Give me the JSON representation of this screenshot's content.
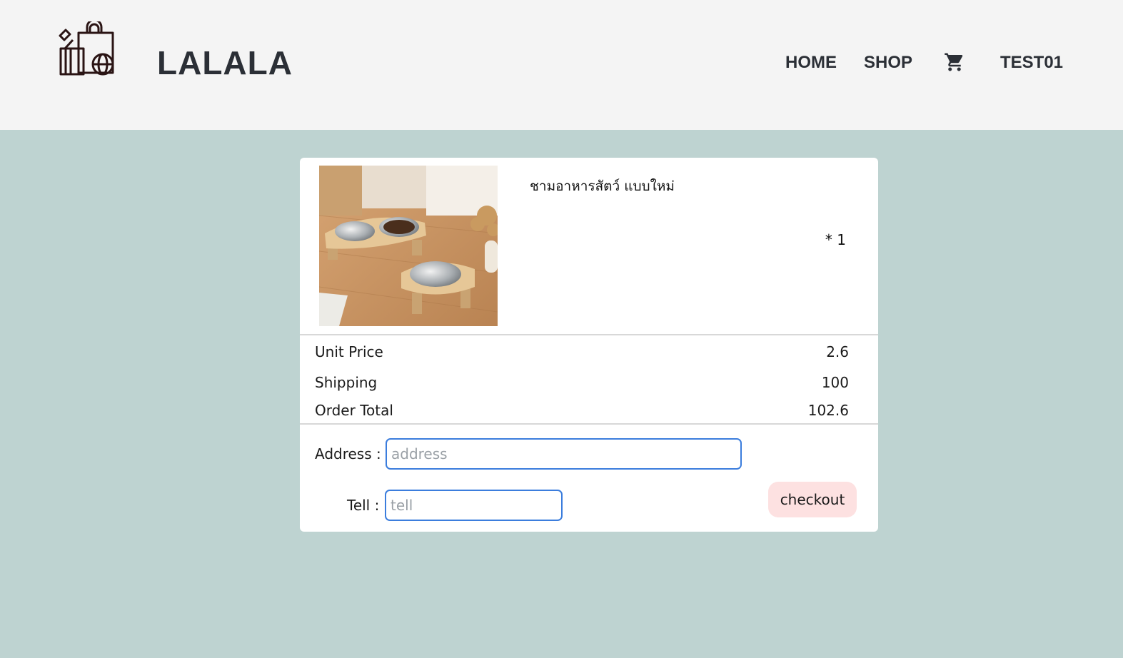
{
  "header": {
    "brand": "LALALA",
    "nav": {
      "home": "HOME",
      "shop": "SHOP",
      "user": "TEST01"
    },
    "icons": {
      "logo": "shopping-bags-icon",
      "cart": "cart-icon"
    }
  },
  "product": {
    "name": "ชามอาหารสัตว์ แบบใหม่",
    "quantity": "* 1",
    "image": "pet-bowls-photo"
  },
  "summary": {
    "unit_price_label": "Unit Price",
    "unit_price": "2.6",
    "shipping_label": "Shipping",
    "shipping": "100",
    "total_label": "Order Total",
    "total": "102.6"
  },
  "form": {
    "address_label": "Address :",
    "address_placeholder": "address",
    "address_value": "",
    "tell_label": "Tell :",
    "tell_placeholder": "tell",
    "tell_value": "",
    "checkout_label": "checkout"
  },
  "colors": {
    "header_bg": "#f4f4f4",
    "page_bg": "#bed3d1",
    "input_border": "#3b7ddd",
    "checkout_bg": "#fde1e1"
  }
}
